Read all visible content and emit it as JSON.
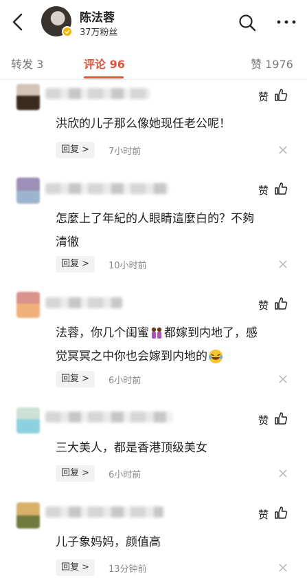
{
  "header": {
    "user_name": "陈法蓉",
    "fans": "37万粉丝",
    "icons": [
      "back-arrow-icon",
      "search-icon",
      "more-icon",
      "verified-badge-icon"
    ]
  },
  "tabs": {
    "repost": "转发 3",
    "comments": "评论 96",
    "likes": "赞 1976",
    "active": "comments",
    "accent": "#e2533a"
  },
  "comments": [
    {
      "text": "洪欣的儿子那么像她现任老公呢！",
      "like_label": "赞",
      "reply": "回复 >",
      "time": "7小时前"
    },
    {
      "text_lines": [
        "怎麼上了年紀的人眼睛這麼白的？不夠",
        "清徹"
      ],
      "like_label": "赞",
      "reply": "回复 >",
      "time": "10小时前"
    },
    {
      "text_lines": [
        "法蓉，你几个闺蜜",
        "都嫁到内地了，感",
        "觉冥冥之中你也会嫁到内地的"
      ],
      "emojis": [
        "couple-emoji",
        "laughing-tears-emoji"
      ],
      "like_label": "赞",
      "reply": "回复 >",
      "time": "6小时前"
    },
    {
      "text": "三大美人，都是香港顶级美女",
      "like_label": "赞",
      "reply": "回复 >",
      "time": "6小时前"
    },
    {
      "text": "儿子象妈妈，颜值高",
      "like_label": "赞",
      "reply": "回复 >",
      "time": "13分钟前"
    }
  ]
}
